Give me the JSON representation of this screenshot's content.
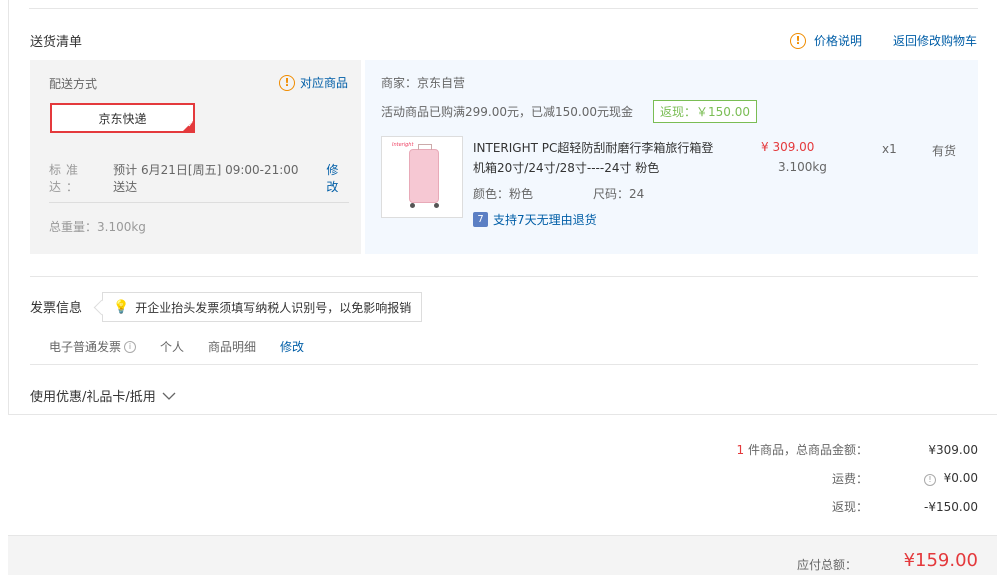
{
  "delivery": {
    "section_title": "送货清单",
    "price_note": "价格说明",
    "back_link": "返回修改购物车",
    "ship_method_label": "配送方式",
    "match_goods": "对应商品",
    "ship_method": "京东快递",
    "eta_key": "标准达：",
    "eta_value": "预计 6月21日[周五] 09:00-21:00 送达",
    "eta_edit": "修改",
    "total_weight": "总重量：3.100kg"
  },
  "goods": {
    "merchant": "商家：京东自营",
    "promo": "活动商品已购满299.00元，已减150.00元现金",
    "cashback": "返现：￥150.00",
    "brand_logo": "Interight",
    "title": "INTERIGHT PC超轻防刮耐磨行李箱旅行箱登机箱20寸/24寸/28寸----24寸 粉色",
    "color": "颜色：粉色",
    "size": "尺码：24",
    "return_icon_text": "7",
    "return_policy": "支持7天无理由退货",
    "price": "¥ 309.00",
    "weight": "3.100kg",
    "qty": "x1",
    "stock": "有货"
  },
  "invoice": {
    "title": "发票信息",
    "tip": "开企业抬头发票须填写纳税人识别号，以免影响报销",
    "type": "电子普通发票",
    "personal": "个人",
    "detail": "商品明细",
    "edit": "修改"
  },
  "coupon": {
    "label": "使用优惠/礼品卡/抵用"
  },
  "summary": {
    "count": "1",
    "count_label": " 件商品，总商品金额：",
    "goods_total": "¥309.00",
    "shipping_label": "运费：",
    "shipping": "¥0.00",
    "cashback_label": "返现：",
    "cashback": "-¥150.00",
    "payable_label": "应付总额：",
    "payable": "¥159.00"
  },
  "colors": {
    "accent_red": "#e4393c",
    "link_blue": "#005ea7",
    "cashback_green": "#7abd54",
    "warning_orange": "#f08c00"
  }
}
